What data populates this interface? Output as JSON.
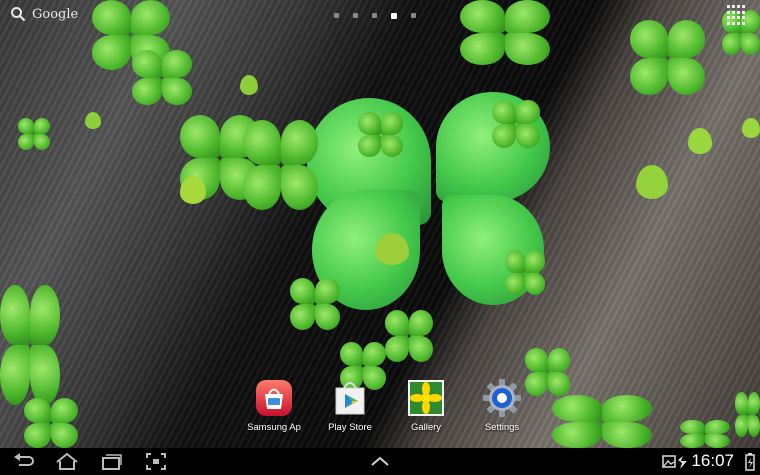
{
  "search": {
    "label": "Google",
    "icon": "search-icon"
  },
  "pages": {
    "count": 5,
    "active_index": 3
  },
  "apps_button": {
    "icon": "apps-grid-icon"
  },
  "dock": {
    "apps": [
      {
        "label": "Samsung Ap",
        "icon": "samsung-apps-icon"
      },
      {
        "label": "Play Store",
        "icon": "play-store-icon"
      },
      {
        "label": "Gallery",
        "icon": "gallery-icon"
      },
      {
        "label": "Settings",
        "icon": "settings-gear-icon"
      }
    ]
  },
  "navbar": {
    "back_icon": "back-icon",
    "home_icon": "home-icon",
    "recents_icon": "recent-apps-icon",
    "screenshot_icon": "screenshot-icon",
    "up_icon": "chevron-up-icon",
    "time": "16:07"
  },
  "colors": {
    "clover_green": "#4db82c",
    "navbar": "#000000"
  }
}
